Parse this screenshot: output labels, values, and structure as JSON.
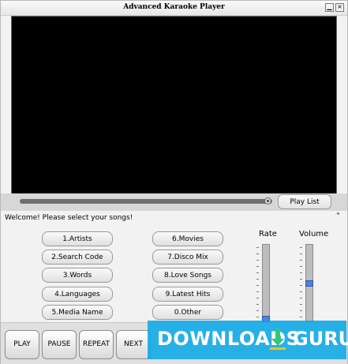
{
  "window": {
    "title": "Advanced Karaoke Player",
    "minimize_icon": "minimize-icon",
    "close_icon": "close-icon"
  },
  "seek": {
    "progress_fraction": 0.98,
    "playlist_label": "Play List"
  },
  "panel": {
    "welcome_text": "Welcome!  Please select your songs!",
    "collapse_icon": "double-chevron-up-icon"
  },
  "song_buttons_left": [
    "1.Artists",
    "2.Search Code",
    "3.Words",
    "4.Languages",
    "5.Media Name"
  ],
  "song_buttons_right": [
    "6.Movies",
    "7.Disco Mix",
    "8.Love Songs",
    "9.Latest Hits",
    "0.Other"
  ],
  "rate": {
    "label": "Rate",
    "level_fraction": 0.0
  },
  "volume": {
    "label": "Volume",
    "level_fraction": 0.5
  },
  "controls": [
    "PLAY",
    "PAUSE",
    "REPEAT",
    "NEXT"
  ],
  "watermark": {
    "text": "DOWNLOADS",
    "suffix": "GURU",
    "color": "#08a8e6",
    "icon": "download-arrow-icon"
  },
  "colors": {
    "video_background": "#000000",
    "slider_thumb": "#4f83d6"
  }
}
